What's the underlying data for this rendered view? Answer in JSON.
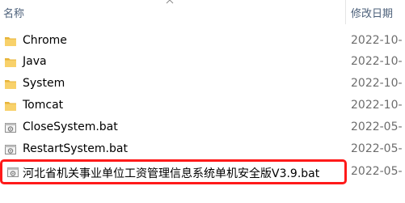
{
  "header": {
    "name_label": "名称",
    "date_label": "修改日期"
  },
  "files": [
    {
      "name": "Chrome",
      "date": "2022-10-",
      "icon": "folder-icon"
    },
    {
      "name": "Java",
      "date": "2022-10-",
      "icon": "folder-icon"
    },
    {
      "name": "System",
      "date": "2022-10-",
      "icon": "folder-icon"
    },
    {
      "name": "Tomcat",
      "date": "2022-10-",
      "icon": "folder-icon"
    },
    {
      "name": "CloseSystem.bat",
      "date": "2022-05-",
      "icon": "batch-file-icon"
    },
    {
      "name": "RestartSystem.bat",
      "date": "2022-05-",
      "icon": "batch-file-icon"
    },
    {
      "name": "河北省机关事业单位工资管理信息系统单机安全版V3.9.bat",
      "date": "2022-05-",
      "icon": "batch-file-icon"
    }
  ],
  "colors": {
    "folder": "#f4c542",
    "highlight_border": "#ff1a1a",
    "header_text": "#4c607a"
  }
}
